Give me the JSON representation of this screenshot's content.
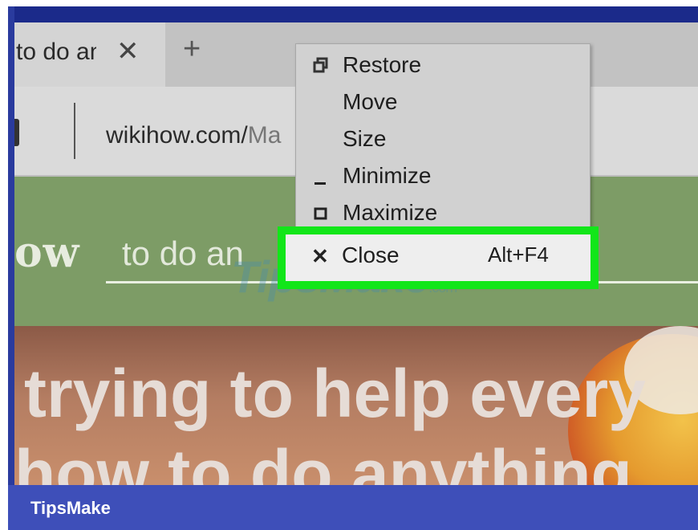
{
  "browser": {
    "tab": {
      "title": "to do an",
      "close_glyph": "✕"
    },
    "new_tab_glyph": "+",
    "address": {
      "url_main": "wikihow.com/",
      "url_dim": "Ma"
    }
  },
  "page": {
    "logo_fragment": "ow",
    "search_text": "to do an",
    "hero_line1": "trying to help every",
    "hero_line2": "how to do anything"
  },
  "context_menu": {
    "items": [
      {
        "label": "Restore",
        "icon": "restore-icon"
      },
      {
        "label": "Move",
        "icon": ""
      },
      {
        "label": "Size",
        "icon": ""
      },
      {
        "label": "Minimize",
        "icon": "minimize-icon"
      },
      {
        "label": "Maximize",
        "icon": "maximize-icon"
      }
    ],
    "close": {
      "label": "Close",
      "shortcut": "Alt+F4",
      "icon": "close-icon"
    }
  },
  "highlight_color": "#12e619",
  "watermark": {
    "text": "TipsMake",
    "suffix": ".com"
  },
  "brand": {
    "text": "TipsMake",
    "bar_color": "#3e4fb9"
  }
}
